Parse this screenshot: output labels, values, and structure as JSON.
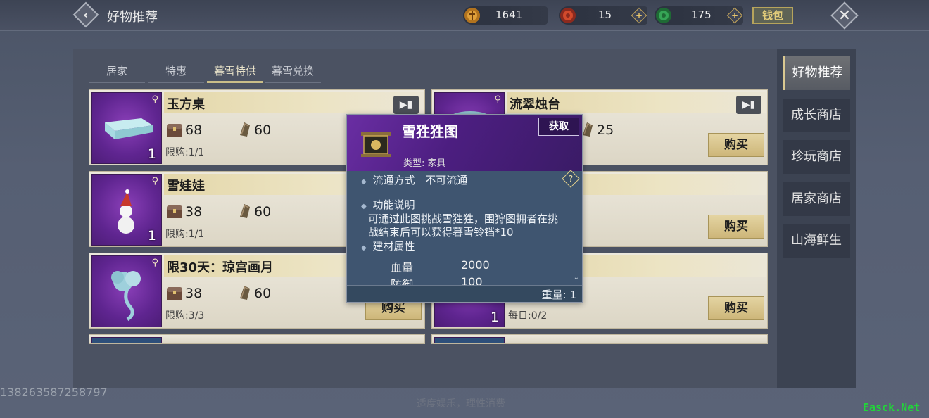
{
  "header": {
    "title": "好物推荐",
    "currencies": [
      {
        "icon": "gold-coin-icon",
        "value": "1641"
      },
      {
        "icon": "red-jade-icon",
        "value": "15"
      },
      {
        "icon": "green-jade-icon",
        "value": "175"
      }
    ],
    "wallet_label": "钱包"
  },
  "tabs": [
    {
      "label": "居家",
      "active": false
    },
    {
      "label": "特惠",
      "active": false
    },
    {
      "label": "暮雪特供",
      "active": true
    },
    {
      "label": "暮雪兑换",
      "active": false
    }
  ],
  "items": [
    {
      "name": "玉方桌",
      "price1": "68",
      "price2": "60",
      "limit": "限购:1/1",
      "qty": "1"
    },
    {
      "name": "流翠烛台",
      "price1": "",
      "price2": "25",
      "limit": "",
      "qty": "",
      "buy_label": "购买"
    },
    {
      "name": "雪娃娃",
      "price1": "38",
      "price2": "60",
      "limit": "限购:1/1",
      "qty": "1"
    },
    {
      "name": "",
      "price1": "",
      "price2": "",
      "limit": "",
      "qty": "",
      "buy_label": "购买"
    },
    {
      "name": "限30天：琼宫画月",
      "price1": "38",
      "price2": "60",
      "limit": "限购:3/3",
      "qty": "",
      "buy_label": "购买"
    },
    {
      "name": "",
      "price1": "",
      "price2": "",
      "limit": "每日:0/2",
      "qty": "1",
      "buy_label": "购买"
    }
  ],
  "sidebar": [
    {
      "label": "好物推荐",
      "active": true
    },
    {
      "label": "成长商店",
      "active": false
    },
    {
      "label": "珍玩商店",
      "active": false
    },
    {
      "label": "居家商店",
      "active": false
    },
    {
      "label": "山海鲜生",
      "active": false
    }
  ],
  "popup": {
    "name": "雪狌狌图",
    "obtain_label": "获取",
    "type": "类型: 家具",
    "circulation_label": "流通方式",
    "circulation_value": "不可流通",
    "function_title": "功能说明",
    "function_line1": "可通过此图挑战雪狌狌，围狩图拥者在挑",
    "function_line2": "战结束后可以获得暮雪铃铛*10",
    "material_title": "建材属性",
    "stats": [
      {
        "k": "血量",
        "v": "2000"
      },
      {
        "k": "防御",
        "v": "100"
      }
    ],
    "weight": "重量: 1",
    "help_glyph": "?"
  },
  "footer": {
    "uid": "138263587258797",
    "slogan": "适度娱乐，理性消费",
    "watermark": "Easck.Net"
  }
}
